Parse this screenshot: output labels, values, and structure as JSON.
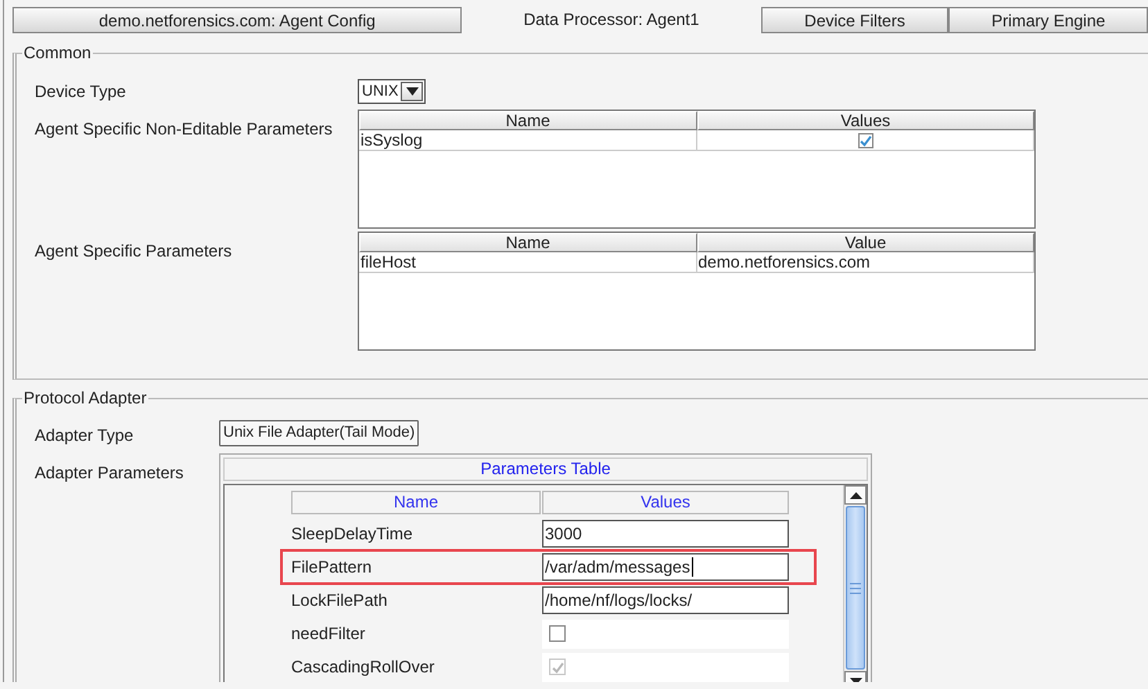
{
  "tabs": [
    {
      "label": "demo.netforensics.com: Agent Config",
      "selected": false
    },
    {
      "label": "Data Processor: Agent1",
      "selected": true
    },
    {
      "label": "Device Filters",
      "selected": false
    },
    {
      "label": "Primary Engine",
      "selected": false
    }
  ],
  "common": {
    "title": "Common",
    "device_type": {
      "label": "Device Type",
      "value": "UNIX"
    },
    "non_editable": {
      "label": "Agent Specific Non-Editable Parameters",
      "columns": [
        "Name",
        "Values"
      ],
      "rows": [
        {
          "name": "isSyslog",
          "checked": true
        }
      ]
    },
    "agent_params": {
      "label": "Agent Specific Parameters",
      "columns": [
        "Name",
        "Value"
      ],
      "rows": [
        {
          "name": "fileHost",
          "value": "demo.netforensics.com"
        }
      ]
    }
  },
  "protocol_adapter": {
    "title": "Protocol Adapter",
    "adapter_type": {
      "label": "Adapter Type",
      "value": "Unix File Adapter(Tail Mode)"
    },
    "adapter_parameters": {
      "label": "Adapter Parameters",
      "title": "Parameters Table",
      "columns": [
        "Name",
        "Values"
      ],
      "rows": [
        {
          "name": "SleepDelayTime",
          "kind": "text",
          "value": "3000",
          "highlighted": false,
          "focused": false
        },
        {
          "name": "FilePattern",
          "kind": "text",
          "value": "/var/adm/messages",
          "highlighted": true,
          "focused": true
        },
        {
          "name": "LockFilePath",
          "kind": "text",
          "value": "/home/nf/logs/locks/",
          "highlighted": false,
          "focused": false
        },
        {
          "name": "needFilter",
          "kind": "checkbox",
          "checked": false,
          "disabled": false,
          "highlighted": false
        },
        {
          "name": "CascadingRollOver",
          "kind": "checkbox",
          "checked": true,
          "disabled": true,
          "highlighted": false
        }
      ]
    }
  }
}
